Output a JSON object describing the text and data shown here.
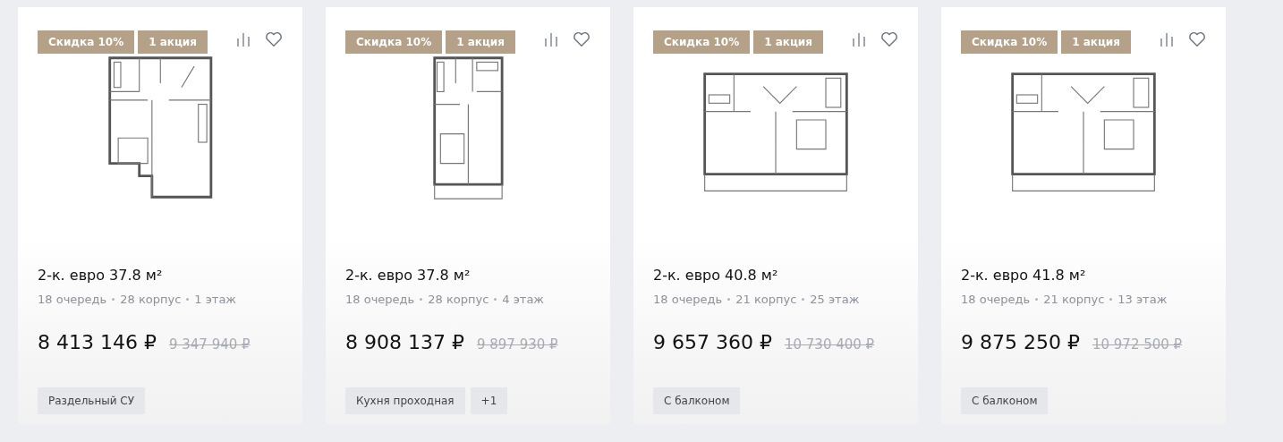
{
  "cards": [
    {
      "badges": [
        "Скидка 10%",
        "1 акция"
      ],
      "kind": "a",
      "title": "2-к. евро 37.8 м²",
      "meta": [
        "18 очередь",
        "28 корпус",
        "1 этаж"
      ],
      "price": "8 413 146 ₽",
      "old_price": "9 347 940 ₽",
      "tags": [
        "Раздельный СУ"
      ]
    },
    {
      "badges": [
        "Скидка 10%",
        "1 акция"
      ],
      "kind": "b",
      "title": "2-к. евро 37.8 м²",
      "meta": [
        "18 очередь",
        "28 корпус",
        "4 этаж"
      ],
      "price": "8 908 137 ₽",
      "old_price": "9 897 930 ₽",
      "tags": [
        "Кухня проходная",
        "+1"
      ]
    },
    {
      "badges": [
        "Скидка 10%",
        "1 акция"
      ],
      "kind": "c",
      "title": "2-к. евро 40.8 м²",
      "meta": [
        "18 очередь",
        "21 корпус",
        "25 этаж"
      ],
      "price": "9 657 360 ₽",
      "old_price": "10 730 400 ₽",
      "tags": [
        "С балконом"
      ]
    },
    {
      "badges": [
        "Скидка 10%",
        "1 акция"
      ],
      "kind": "c",
      "title": "2-к. евро 41.8 м²",
      "meta": [
        "18 очередь",
        "21 корпус",
        "13 этаж"
      ],
      "price": "9 875 250 ₽",
      "old_price": "10 972 500 ₽",
      "tags": [
        "С балконом"
      ]
    }
  ]
}
